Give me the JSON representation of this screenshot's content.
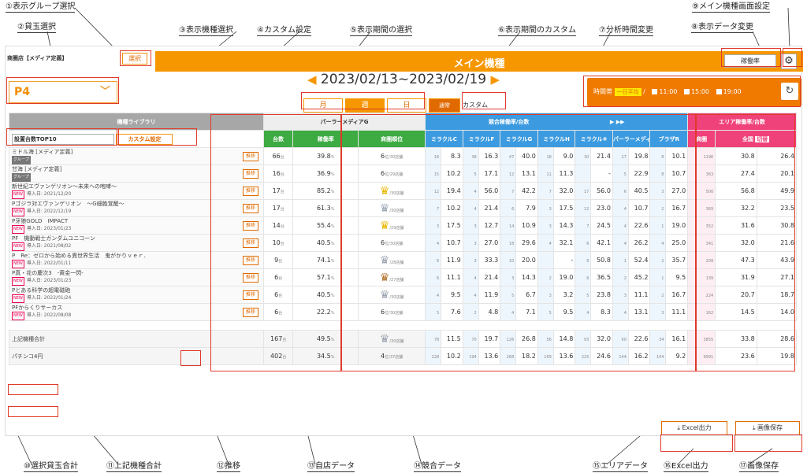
{
  "callouts": {
    "c1": "①表示グループ選択",
    "c2": "②貸玉選択",
    "c3": "③表示機種選択",
    "c4": "④カスタム設定",
    "c5": "⑤表示期間の選択",
    "c6": "⑥表示期間のカスタム",
    "c7": "⑦分析時間変更",
    "c8": "⑧表示データ変更",
    "c9": "⑨メイン機種画面設定",
    "c10": "⑩選択貸玉合計",
    "c11": "⑪上記機種合計",
    "c12": "⑫推移",
    "c13": "⑬自店データ",
    "c14": "⑭競合データ",
    "c15": "⑮エリアデータ",
    "c16": "⑯Excel出力",
    "c17": "⑰画像保存"
  },
  "header": {
    "store": "商圏店【メディア定義】",
    "select_label": "選択",
    "title": "メイン機種",
    "rate_select": "稼働率",
    "gear": "⚙"
  },
  "ball": {
    "value": "P4",
    "chev": "﹀"
  },
  "period": {
    "left_arrow": "◀",
    "range": "2023/02/13~2023/02/19",
    "right_arrow": "▶",
    "month": "月",
    "week": "週",
    "day": "日",
    "normal": "通常",
    "custom": "カスタム"
  },
  "time": {
    "label": "時間帯",
    "chip": "一日平均",
    "sep": "/",
    "t1": "11:00",
    "t2": "15:00",
    "t3": "19:00",
    "refresh": "↻"
  },
  "grid": {
    "library": "機種ライブラリ",
    "top10": "設置台数TOP10",
    "custom_btn": "カスタム設定",
    "own": "パーラーメディアG",
    "units": "台数",
    "rate": "稼働率",
    "rank": "商圏順位",
    "comp": "競合稼働率/台数",
    "area": "エリア稼働率/台数",
    "area_c": "商圏",
    "area_z": "全国",
    "area_chip": "切替",
    "comp_stores": [
      "ミラクルC",
      "ミラクルF",
      "ミラクルG",
      "ミラクルH",
      "ミラクル⑥",
      "パーラーメディアC",
      "ブラザR"
    ],
    "next": "▶",
    "next2": "▶▶",
    "trend": "推移",
    "tag_new": "NEW",
    "tag_grp": "グループ",
    "rows": [
      {
        "name": "ミドル海 [メディア定義]",
        "sub": "",
        "grp": true,
        "units": "66",
        "rate": "39.8",
        "rank": "6",
        "of": "30",
        "crown": "",
        "comp": [
          "16",
          "8.3",
          "38",
          "16.3",
          "47",
          "40.0",
          "18",
          "9.0",
          "30",
          "21.4",
          "27",
          "19.8",
          "8",
          "10.1"
        ],
        "area": [
          "1196",
          "30.8",
          "26.4"
        ]
      },
      {
        "name": "甘海 [メディア定義]",
        "sub": "",
        "grp": true,
        "units": "16",
        "rate": "36.9",
        "rank": "6",
        "of": "29",
        "crown": "",
        "comp": [
          "15",
          "10.2",
          "5",
          "17.1",
          "12",
          "13.1",
          "11",
          "11.3",
          "",
          "-",
          "5",
          "22.9",
          "8",
          "10.7"
        ],
        "area": [
          "363",
          "27.4",
          "20.1"
        ]
      },
      {
        "name": "新世紀エヴァンゲリオン～未来への咆哮～",
        "sub": "導入日: 2021/12/20",
        "grp": false,
        "units": "17",
        "rate": "85.2",
        "rank": "1",
        "of": "30",
        "crown": "gold",
        "comp": [
          "12",
          "19.4",
          "4",
          "56.0",
          "7",
          "42.2",
          "7",
          "32.0",
          "17",
          "56.0",
          "6",
          "40.5",
          "3",
          "27.0"
        ],
        "area": [
          "500",
          "56.8",
          "49.9"
        ]
      },
      {
        "name": "Pゴジラ対エヴァンゲリオン　～G細胞覚醒～",
        "sub": "導入日: 2022/12/19",
        "grp": false,
        "units": "17",
        "rate": "61.3",
        "rank": "2",
        "of": "30",
        "crown": "silver",
        "comp": [
          "7",
          "10.2",
          "4",
          "21.4",
          "6",
          "7.9",
          "3",
          "17.5",
          "12",
          "23.0",
          "4",
          "10.7",
          "2",
          "16.7"
        ],
        "area": [
          "369",
          "32.2",
          "23.5"
        ]
      },
      {
        "name": "P牙狼GOLD　IMPACT",
        "sub": "導入日: 2023/01/23",
        "grp": false,
        "units": "14",
        "rate": "55.4",
        "rank": "1",
        "of": "29",
        "crown": "gold",
        "comp": [
          "3",
          "17.5",
          "3",
          "12.7",
          "14",
          "10.9",
          "3",
          "14.3",
          "7",
          "24.5",
          "4",
          "22.6",
          "1",
          "19.0"
        ],
        "area": [
          "352",
          "31.6",
          "30.8"
        ]
      },
      {
        "name": "PF　機動戦士ガンダムユニコーン",
        "sub": "導入日: 2021/08/02",
        "grp": false,
        "units": "10",
        "rate": "40.5",
        "rank": "6",
        "of": "30",
        "crown": "",
        "comp": [
          "4",
          "10.7",
          "3",
          "27.0",
          "18",
          "29.6",
          "4",
          "32.1",
          "6",
          "42.1",
          "4",
          "26.2",
          "4",
          "25.0"
        ],
        "area": [
          "341",
          "32.0",
          "21.6"
        ]
      },
      {
        "name": "P　Re：ゼロから始める異世界生活　鬼がかりｖｅｒ．",
        "sub": "導入日: 2022/01/11",
        "grp": false,
        "units": "9",
        "rate": "74.1",
        "rank": "2",
        "of": "28",
        "crown": "silver",
        "comp": [
          "6",
          "11.9",
          "3",
          "33.3",
          "10",
          "20.0",
          "",
          "-",
          "6",
          "50.8",
          "1",
          "52.4",
          "2",
          "35.7"
        ],
        "area": [
          "209",
          "47.3",
          "43.9"
        ]
      },
      {
        "name": "P真・花の慶次3　-黄金一閃-",
        "sub": "導入日: 2023/01/23",
        "grp": false,
        "units": "6",
        "rate": "57.1",
        "rank": "3",
        "of": "27",
        "crown": "bronze",
        "comp": [
          "6",
          "11.1",
          "4",
          "21.4",
          "3",
          "14.3",
          "2",
          "19.0",
          "6",
          "36.5",
          "2",
          "45.2",
          "1",
          "9.5"
        ],
        "area": [
          "139",
          "31.9",
          "27.1"
        ]
      },
      {
        "name": "Pとある科学の超電磁砲",
        "sub": "導入日: 2022/01/24",
        "grp": false,
        "units": "6",
        "rate": "40.5",
        "rank": "2",
        "of": "30",
        "crown": "silver",
        "comp": [
          "4",
          "9.5",
          "4",
          "11.9",
          "5",
          "6.7",
          "3",
          "3.2",
          "5",
          "23.8",
          "3",
          "11.1",
          "2",
          "16.7"
        ],
        "area": [
          "224",
          "20.7",
          "18.7"
        ]
      },
      {
        "name": "PFからくりサーカス",
        "sub": "導入日: 2022/08/08",
        "grp": false,
        "units": "6",
        "rate": "22.2",
        "rank": "6",
        "of": "30",
        "crown": "",
        "comp": [
          "5",
          "7.6",
          "2",
          "4.8",
          "4",
          "7.1",
          "5",
          "9.5",
          "4",
          "8.3",
          "4",
          "13.1",
          "3",
          "11.1"
        ],
        "area": [
          "162",
          "14.5",
          "14.0"
        ]
      }
    ],
    "sum1": {
      "name": "上記機種合計",
      "units": "167",
      "rate": "49.5",
      "rank": "2",
      "of": "30",
      "crown": "silver",
      "comp": [
        "78",
        "11.5",
        "70",
        "19.7",
        "126",
        "26.8",
        "56",
        "14.8",
        "93",
        "32.0",
        "60",
        "22.6",
        "34",
        "16.1"
      ],
      "area": [
        "3855",
        "33.8",
        "28.6"
      ]
    },
    "sum2": {
      "name": "パチンコ4円",
      "units": "402",
      "rate": "34.5",
      "rank": "4",
      "of": "37",
      "crown": "",
      "comp": [
        "228",
        "10.2",
        "194",
        "13.6",
        "268",
        "18.2",
        "169",
        "13.6",
        "225",
        "24.6",
        "144",
        "16.2",
        "104",
        "9.2"
      ],
      "area": [
        "9991",
        "23.6",
        "19.8"
      ]
    }
  },
  "units": {
    "dai": "台",
    "pct": "%",
    "i": "位",
    "store": "店舗"
  },
  "footer": {
    "excel": "Excel出力",
    "image": "画像保存",
    "dl": "⤓"
  }
}
